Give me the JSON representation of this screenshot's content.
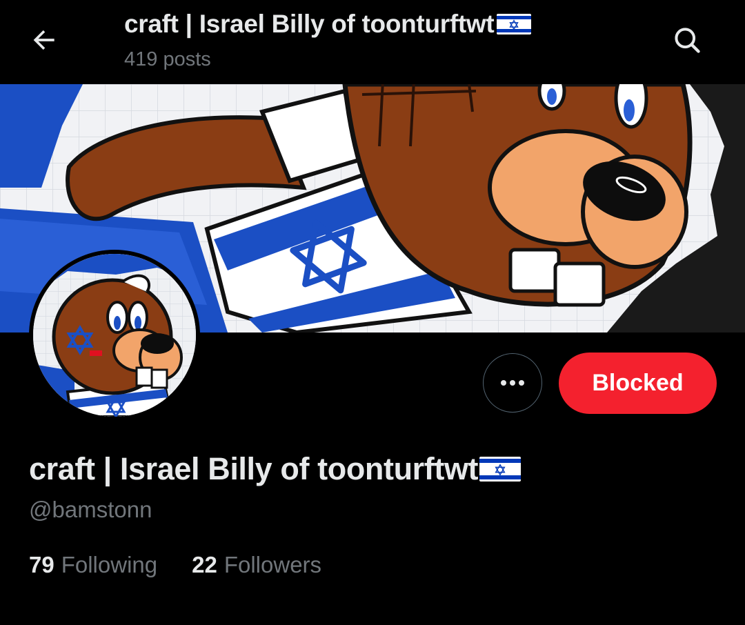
{
  "header": {
    "title": "craft | Israel Billy of toonturftwt",
    "flag_icon": "israel-flag-icon",
    "post_count": "419 posts",
    "back_icon": "arrow-left-icon",
    "search_icon": "search-icon"
  },
  "profile": {
    "display_name": "craft | Israel Billy of toonturftwt",
    "handle": "@bamstonn",
    "following_count": "79",
    "following_label": "Following",
    "followers_count": "22",
    "followers_label": "Followers"
  },
  "actions": {
    "more_icon": "more-horizontal-icon",
    "blocked_label": "Blocked"
  },
  "colors": {
    "background": "#000000",
    "text_primary": "#e7e9ea",
    "text_secondary": "#71767b",
    "blocked_button": "#f4212e",
    "flag_blue": "#0038b8"
  }
}
